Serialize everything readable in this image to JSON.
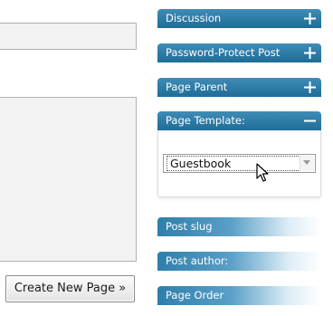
{
  "editor": {
    "create_button_label": "Create New Page »"
  },
  "sidebar": {
    "boxes": [
      {
        "label": "Discussion",
        "state": "collapsed",
        "icon": "plus-icon"
      },
      {
        "label": "Password-Protect Post",
        "state": "collapsed",
        "icon": "plus-icon"
      },
      {
        "label": "Page Parent",
        "state": "collapsed",
        "icon": "plus-icon"
      },
      {
        "label": "Page Template:",
        "state": "expanded",
        "icon": "minus-icon"
      },
      {
        "label": "Post slug",
        "state": "collapsed"
      },
      {
        "label": "Post author:",
        "state": "collapsed"
      },
      {
        "label": "Page Order",
        "state": "collapsed"
      }
    ],
    "template_select": {
      "selected": "Guestbook",
      "icon": "chevron-down-icon"
    }
  },
  "colors": {
    "header_blue": "#2f7eab",
    "header_blue_dark": "#1f6c97",
    "field_background": "#f3f3f3"
  },
  "pointer": {
    "icon": "arrow-cursor-icon"
  }
}
